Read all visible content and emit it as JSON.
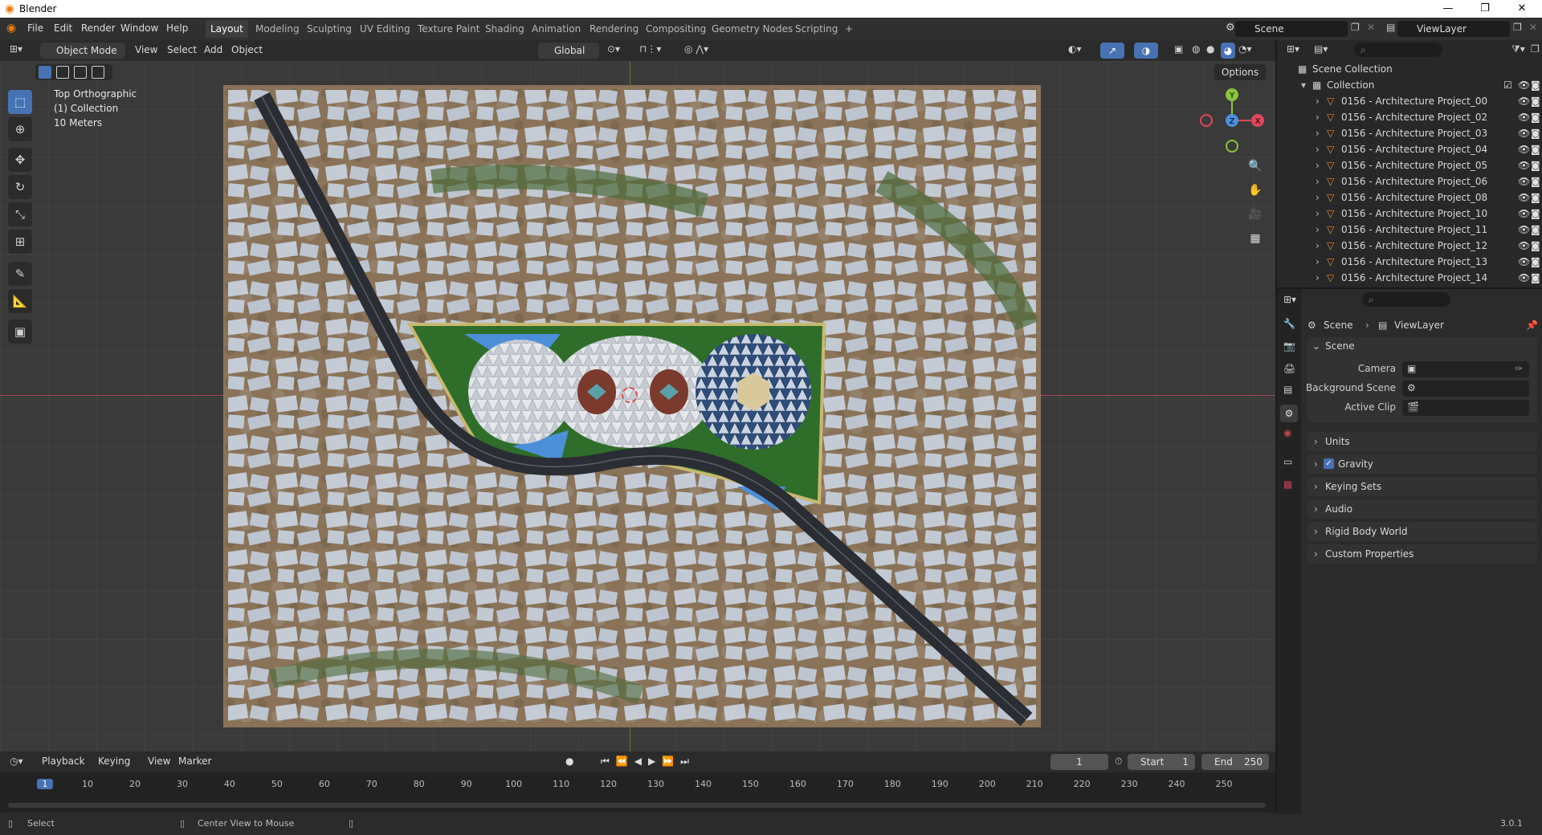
{
  "window": {
    "title": "Blender"
  },
  "menubar": [
    "File",
    "Edit",
    "Render",
    "Window",
    "Help"
  ],
  "workspaces": [
    "Layout",
    "Modeling",
    "Sculpting",
    "UV Editing",
    "Texture Paint",
    "Shading",
    "Animation",
    "Rendering",
    "Compositing",
    "Geometry Nodes",
    "Scripting",
    "+"
  ],
  "active_workspace": "Layout",
  "scene_field": "Scene",
  "viewlayer_field": "ViewLayer",
  "viewport_header": {
    "mode": "Object Mode",
    "menus": [
      "View",
      "Select",
      "Add",
      "Object"
    ],
    "transform_orientation": "Global",
    "options": "Options"
  },
  "viewport_overlay": {
    "view_name": "Top Orthographic",
    "collection": "(1) Collection",
    "scale": "10 Meters"
  },
  "gizmo": {
    "x": "X",
    "y": "Y",
    "z": "Z"
  },
  "outliner": {
    "root": "Scene Collection",
    "collection": "Collection",
    "objects": [
      "0156 - Architecture Project_00",
      "0156 - Architecture Project_02",
      "0156 - Architecture Project_03",
      "0156 - Architecture Project_04",
      "0156 - Architecture Project_05",
      "0156 - Architecture Project_06",
      "0156 - Architecture Project_08",
      "0156 - Architecture Project_10",
      "0156 - Architecture Project_11",
      "0156 - Architecture Project_12",
      "0156 - Architecture Project_13",
      "0156 - Architecture Project_14"
    ]
  },
  "properties": {
    "breadcrumb": {
      "scene": "Scene",
      "viewlayer": "ViewLayer"
    },
    "scene_panel": "Scene",
    "fields": [
      "Camera",
      "Background Scene",
      "Active Clip"
    ],
    "panels": [
      "Units",
      "Gravity",
      "Keying Sets",
      "Audio",
      "Rigid Body World",
      "Custom Properties"
    ],
    "gravity_checked": true
  },
  "timeline": {
    "menus": [
      "Playback",
      "Keying",
      "View",
      "Marker"
    ],
    "current_frame": "1",
    "start_label": "Start",
    "start": "1",
    "end_label": "End",
    "end": "250",
    "ticks": [
      "1",
      "10",
      "20",
      "30",
      "40",
      "50",
      "60",
      "70",
      "80",
      "90",
      "100",
      "110",
      "120",
      "130",
      "140",
      "150",
      "160",
      "170",
      "180",
      "190",
      "200",
      "210",
      "220",
      "230",
      "240",
      "250"
    ]
  },
  "statusbar": {
    "select": "Select",
    "center_view": "Center View to Mouse",
    "version": "3.0.1"
  },
  "colors": {
    "accent": "#4772b3",
    "x_axis": "#e0475b",
    "y_axis": "#8ac43f",
    "z_axis": "#4d8fe0",
    "object_icon": "#e38a3c"
  }
}
